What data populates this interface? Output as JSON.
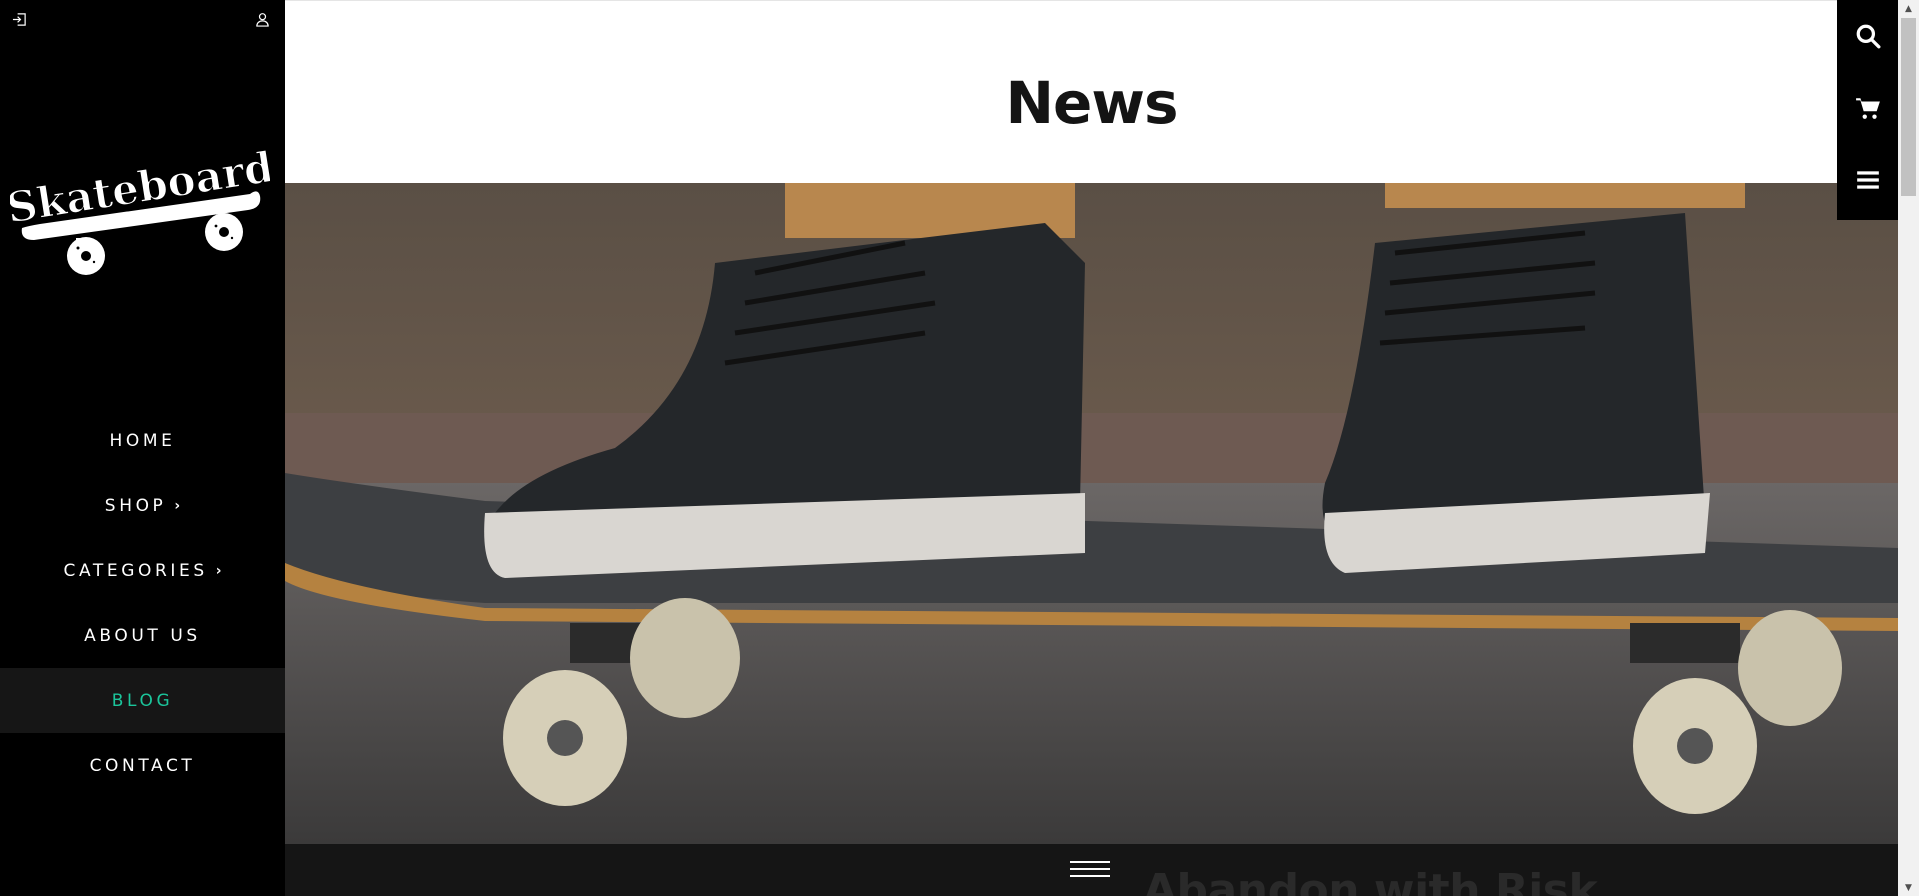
{
  "header": {
    "login_icon": "login-icon",
    "account_icon": "user-icon"
  },
  "logo": {
    "text": "Skateboard"
  },
  "nav": {
    "items": [
      {
        "label": "HOME",
        "has_submenu": false,
        "active": false
      },
      {
        "label": "SHOP",
        "has_submenu": true,
        "active": false
      },
      {
        "label": "CATEGORIES",
        "has_submenu": true,
        "active": false
      },
      {
        "label": "ABOUT US",
        "has_submenu": false,
        "active": false
      },
      {
        "label": "BLOG",
        "has_submenu": false,
        "active": true
      },
      {
        "label": "CONTACT",
        "has_submenu": false,
        "active": false
      }
    ],
    "active_color": "#1bc59b"
  },
  "page": {
    "title": "News"
  },
  "hero": {
    "image": "skateboard-sneakers-photo"
  },
  "post": {
    "title_peek": "Abandon with Risk"
  },
  "toolbar": {
    "items": [
      "search-icon",
      "cart-icon",
      "menu-icon"
    ]
  },
  "colors": {
    "sidebar_bg": "#000000",
    "accent": "#1bc59b",
    "title": "#141414"
  }
}
